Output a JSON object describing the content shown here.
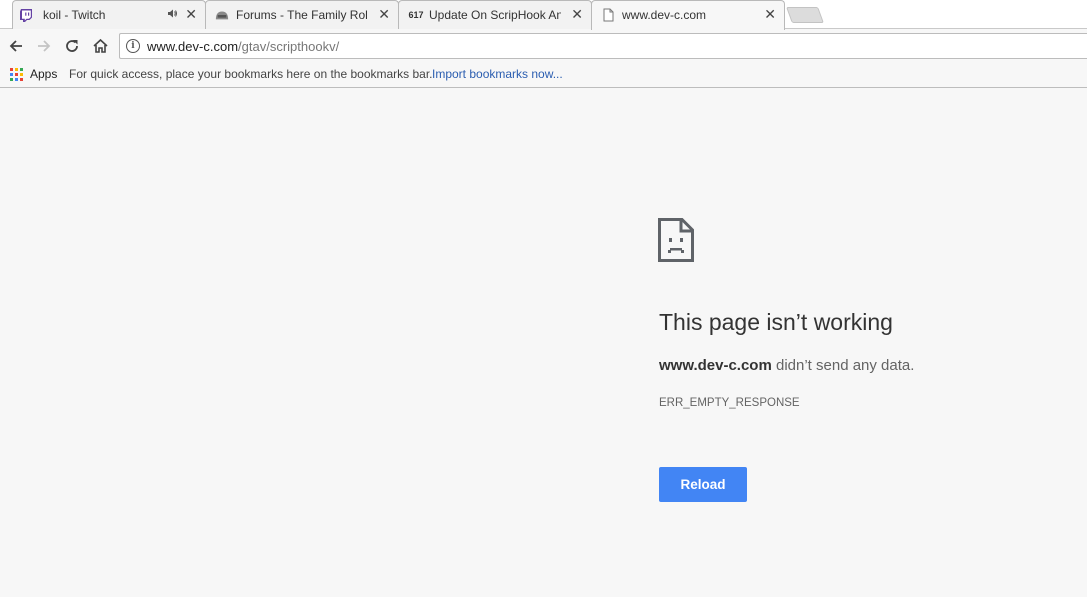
{
  "tabs": [
    {
      "title": "koil - Twitch",
      "favicon": "twitch-icon",
      "audio": true
    },
    {
      "title": "Forums - The Family Role",
      "favicon": "forum-icon",
      "audio": false
    },
    {
      "title": "Update On ScripHook An",
      "favicon": "dev-c-icon",
      "favicon_text": "617",
      "audio": false
    },
    {
      "title": "www.dev-c.com",
      "favicon": "page-icon",
      "audio": false,
      "active": true
    }
  ],
  "toolbar": {
    "url_host": "www.dev-c.com",
    "url_path": "/gtav/scripthookv/"
  },
  "bookmarks": {
    "apps_label": "Apps",
    "hint": "For quick access, place your bookmarks here on the bookmarks bar.",
    "import_link": "Import bookmarks now..."
  },
  "error": {
    "title": "This page isn’t working",
    "host": "www.dev-c.com",
    "message": "didn’t send any data.",
    "code": "ERR_EMPTY_RESPONSE",
    "reload_label": "Reload"
  },
  "colors": {
    "accent": "#4285f4",
    "link": "#2a5db0",
    "twitch": "#6441a4"
  }
}
